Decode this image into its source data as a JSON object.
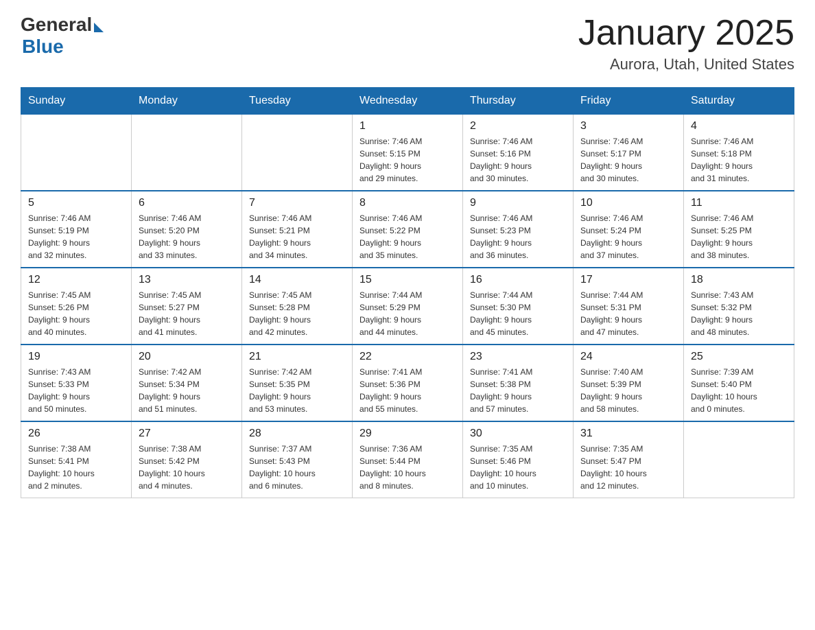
{
  "header": {
    "logo_general": "General",
    "logo_blue": "Blue",
    "month_title": "January 2025",
    "location": "Aurora, Utah, United States"
  },
  "days_of_week": [
    "Sunday",
    "Monday",
    "Tuesday",
    "Wednesday",
    "Thursday",
    "Friday",
    "Saturday"
  ],
  "weeks": [
    [
      {
        "num": "",
        "info": ""
      },
      {
        "num": "",
        "info": ""
      },
      {
        "num": "",
        "info": ""
      },
      {
        "num": "1",
        "info": "Sunrise: 7:46 AM\nSunset: 5:15 PM\nDaylight: 9 hours\nand 29 minutes."
      },
      {
        "num": "2",
        "info": "Sunrise: 7:46 AM\nSunset: 5:16 PM\nDaylight: 9 hours\nand 30 minutes."
      },
      {
        "num": "3",
        "info": "Sunrise: 7:46 AM\nSunset: 5:17 PM\nDaylight: 9 hours\nand 30 minutes."
      },
      {
        "num": "4",
        "info": "Sunrise: 7:46 AM\nSunset: 5:18 PM\nDaylight: 9 hours\nand 31 minutes."
      }
    ],
    [
      {
        "num": "5",
        "info": "Sunrise: 7:46 AM\nSunset: 5:19 PM\nDaylight: 9 hours\nand 32 minutes."
      },
      {
        "num": "6",
        "info": "Sunrise: 7:46 AM\nSunset: 5:20 PM\nDaylight: 9 hours\nand 33 minutes."
      },
      {
        "num": "7",
        "info": "Sunrise: 7:46 AM\nSunset: 5:21 PM\nDaylight: 9 hours\nand 34 minutes."
      },
      {
        "num": "8",
        "info": "Sunrise: 7:46 AM\nSunset: 5:22 PM\nDaylight: 9 hours\nand 35 minutes."
      },
      {
        "num": "9",
        "info": "Sunrise: 7:46 AM\nSunset: 5:23 PM\nDaylight: 9 hours\nand 36 minutes."
      },
      {
        "num": "10",
        "info": "Sunrise: 7:46 AM\nSunset: 5:24 PM\nDaylight: 9 hours\nand 37 minutes."
      },
      {
        "num": "11",
        "info": "Sunrise: 7:46 AM\nSunset: 5:25 PM\nDaylight: 9 hours\nand 38 minutes."
      }
    ],
    [
      {
        "num": "12",
        "info": "Sunrise: 7:45 AM\nSunset: 5:26 PM\nDaylight: 9 hours\nand 40 minutes."
      },
      {
        "num": "13",
        "info": "Sunrise: 7:45 AM\nSunset: 5:27 PM\nDaylight: 9 hours\nand 41 minutes."
      },
      {
        "num": "14",
        "info": "Sunrise: 7:45 AM\nSunset: 5:28 PM\nDaylight: 9 hours\nand 42 minutes."
      },
      {
        "num": "15",
        "info": "Sunrise: 7:44 AM\nSunset: 5:29 PM\nDaylight: 9 hours\nand 44 minutes."
      },
      {
        "num": "16",
        "info": "Sunrise: 7:44 AM\nSunset: 5:30 PM\nDaylight: 9 hours\nand 45 minutes."
      },
      {
        "num": "17",
        "info": "Sunrise: 7:44 AM\nSunset: 5:31 PM\nDaylight: 9 hours\nand 47 minutes."
      },
      {
        "num": "18",
        "info": "Sunrise: 7:43 AM\nSunset: 5:32 PM\nDaylight: 9 hours\nand 48 minutes."
      }
    ],
    [
      {
        "num": "19",
        "info": "Sunrise: 7:43 AM\nSunset: 5:33 PM\nDaylight: 9 hours\nand 50 minutes."
      },
      {
        "num": "20",
        "info": "Sunrise: 7:42 AM\nSunset: 5:34 PM\nDaylight: 9 hours\nand 51 minutes."
      },
      {
        "num": "21",
        "info": "Sunrise: 7:42 AM\nSunset: 5:35 PM\nDaylight: 9 hours\nand 53 minutes."
      },
      {
        "num": "22",
        "info": "Sunrise: 7:41 AM\nSunset: 5:36 PM\nDaylight: 9 hours\nand 55 minutes."
      },
      {
        "num": "23",
        "info": "Sunrise: 7:41 AM\nSunset: 5:38 PM\nDaylight: 9 hours\nand 57 minutes."
      },
      {
        "num": "24",
        "info": "Sunrise: 7:40 AM\nSunset: 5:39 PM\nDaylight: 9 hours\nand 58 minutes."
      },
      {
        "num": "25",
        "info": "Sunrise: 7:39 AM\nSunset: 5:40 PM\nDaylight: 10 hours\nand 0 minutes."
      }
    ],
    [
      {
        "num": "26",
        "info": "Sunrise: 7:38 AM\nSunset: 5:41 PM\nDaylight: 10 hours\nand 2 minutes."
      },
      {
        "num": "27",
        "info": "Sunrise: 7:38 AM\nSunset: 5:42 PM\nDaylight: 10 hours\nand 4 minutes."
      },
      {
        "num": "28",
        "info": "Sunrise: 7:37 AM\nSunset: 5:43 PM\nDaylight: 10 hours\nand 6 minutes."
      },
      {
        "num": "29",
        "info": "Sunrise: 7:36 AM\nSunset: 5:44 PM\nDaylight: 10 hours\nand 8 minutes."
      },
      {
        "num": "30",
        "info": "Sunrise: 7:35 AM\nSunset: 5:46 PM\nDaylight: 10 hours\nand 10 minutes."
      },
      {
        "num": "31",
        "info": "Sunrise: 7:35 AM\nSunset: 5:47 PM\nDaylight: 10 hours\nand 12 minutes."
      },
      {
        "num": "",
        "info": ""
      }
    ]
  ]
}
